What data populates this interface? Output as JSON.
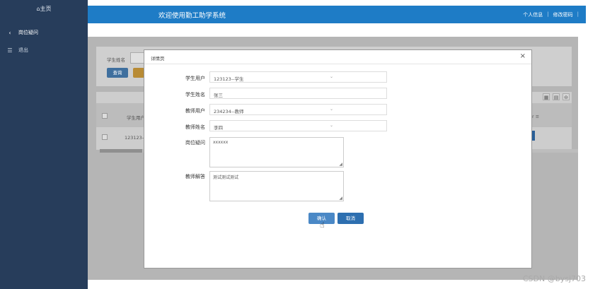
{
  "sidebar": {
    "home": "⌂主页",
    "items": [
      {
        "icon": "‹",
        "icon_name": "chevron-left-icon",
        "label": "岗位疑问"
      },
      {
        "icon": "☰",
        "icon_name": "list-icon",
        "label": "退出"
      }
    ]
  },
  "header": {
    "title": "欢迎使用勤工助学系统",
    "links": [
      "个人信息",
      "修改密码"
    ],
    "separator": "|"
  },
  "background": {
    "search_label": "学生姓名",
    "query_button": "查询",
    "col_student_user": "学生用户",
    "row_student_user": "123123-",
    "col_partial": "r ≡",
    "tool_icons": [
      "grid-icon",
      "print-icon",
      "export-icon"
    ]
  },
  "modal": {
    "title": "详情页",
    "close": "×",
    "fields": [
      {
        "label": "学生用户",
        "value": "123123--学生",
        "type": "select"
      },
      {
        "label": "学生姓名",
        "value": "张三",
        "type": "input"
      },
      {
        "label": "教师用户",
        "value": "234234--教师",
        "type": "select"
      },
      {
        "label": "教师姓名",
        "value": "李四",
        "type": "select"
      }
    ],
    "question_label": "岗位疑问",
    "question_value": "xxxxxx",
    "answer_label": "教师解答",
    "answer_value": "测试测试测试",
    "confirm_label": "确认",
    "cancel_label": "取消"
  },
  "watermark": "CSDN @bysj703",
  "colors": {
    "topbar": "#1e7cc6",
    "sidebar": "#273d5b",
    "button": "#2d6fb0"
  }
}
